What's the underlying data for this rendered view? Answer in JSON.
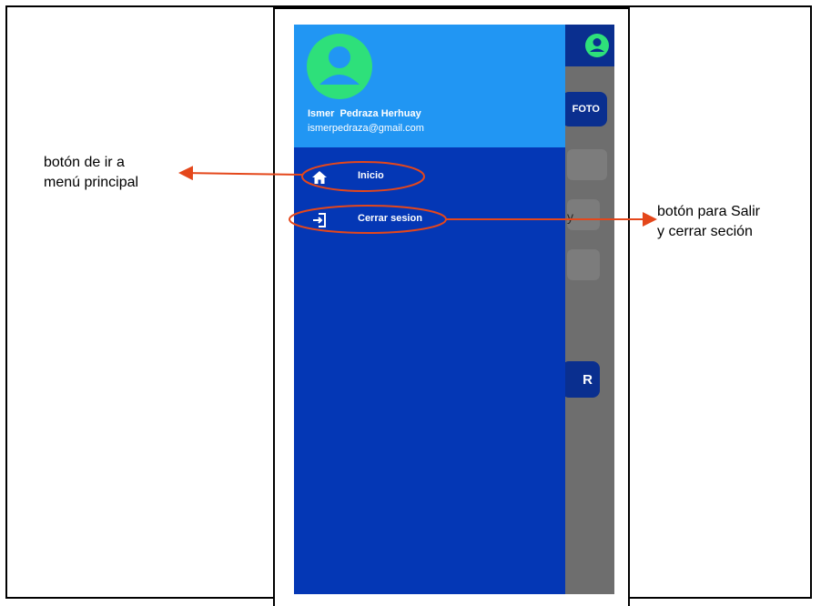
{
  "app": {
    "foto_label": "FOTO",
    "field_fragment": "y",
    "submit_fragment": "R"
  },
  "drawer": {
    "user_name": "Ismer  Pedraza Herhuay",
    "user_email": "ismerpedraza@gmail.com",
    "items": [
      {
        "label": "Inicio",
        "icon": "home-icon"
      },
      {
        "label": "Cerrar sesion",
        "icon": "logout-icon"
      }
    ]
  },
  "annotations": {
    "left": [
      "botón de ir a",
      "menú principal"
    ],
    "right": [
      "botón para Salir",
      "y cerrar seción"
    ]
  },
  "colors": {
    "drawer_header": "#2196f3",
    "drawer_body": "#0437b5",
    "app_bar": "#0a2f8f",
    "avatar": "#2ee07a",
    "annotation": "#e4471b"
  }
}
